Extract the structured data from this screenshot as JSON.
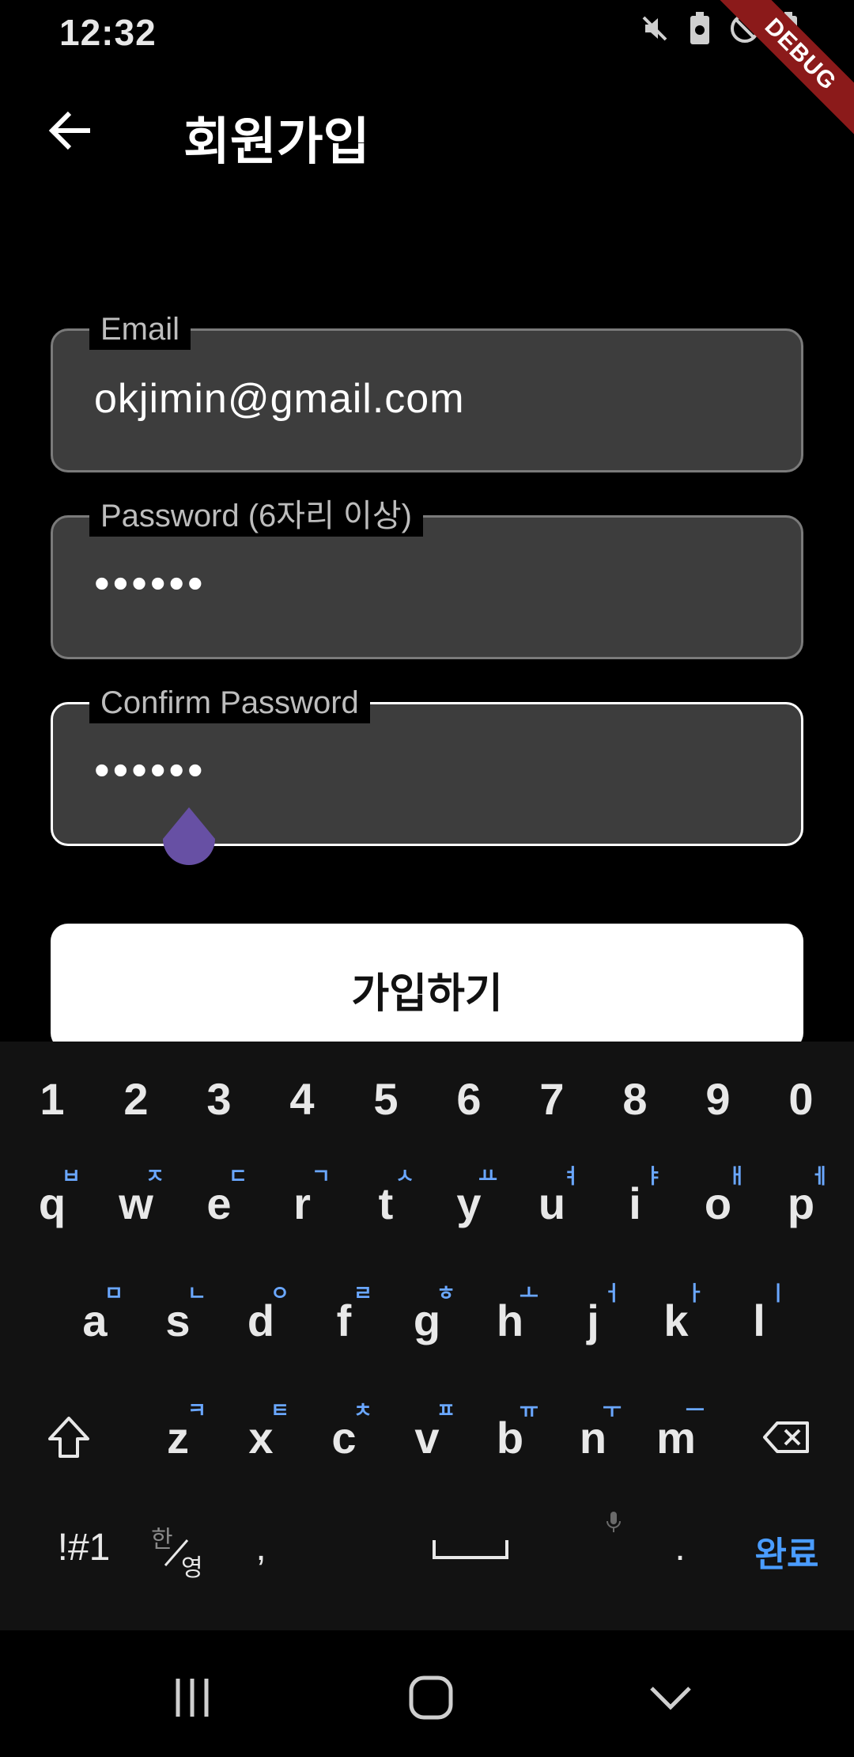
{
  "status_bar": {
    "time": "12:32",
    "debug_label": "DEBUG"
  },
  "app_bar": {
    "title": "회원가입"
  },
  "form": {
    "email": {
      "label": "Email",
      "value": "okjimin@gmail.com"
    },
    "password": {
      "label": "Password (6자리 이상)",
      "value": "••••••"
    },
    "confirm_password": {
      "label": "Confirm Password",
      "value": "••••••"
    },
    "submit_label": "가입하기"
  },
  "keyboard": {
    "number_row": [
      "1",
      "2",
      "3",
      "4",
      "5",
      "6",
      "7",
      "8",
      "9",
      "0"
    ],
    "row1": [
      {
        "key": "q",
        "sub": "ㅂ"
      },
      {
        "key": "w",
        "sub": "ㅈ"
      },
      {
        "key": "e",
        "sub": "ㄷ"
      },
      {
        "key": "r",
        "sub": "ㄱ"
      },
      {
        "key": "t",
        "sub": "ㅅ"
      },
      {
        "key": "y",
        "sub": "ㅛ"
      },
      {
        "key": "u",
        "sub": "ㅕ"
      },
      {
        "key": "i",
        "sub": "ㅑ"
      },
      {
        "key": "o",
        "sub": "ㅐ"
      },
      {
        "key": "p",
        "sub": "ㅔ"
      }
    ],
    "row2": [
      {
        "key": "a",
        "sub": "ㅁ"
      },
      {
        "key": "s",
        "sub": "ㄴ"
      },
      {
        "key": "d",
        "sub": "ㅇ"
      },
      {
        "key": "f",
        "sub": "ㄹ"
      },
      {
        "key": "g",
        "sub": "ㅎ"
      },
      {
        "key": "h",
        "sub": "ㅗ"
      },
      {
        "key": "j",
        "sub": "ㅓ"
      },
      {
        "key": "k",
        "sub": "ㅏ"
      },
      {
        "key": "l",
        "sub": "ㅣ"
      }
    ],
    "row3": [
      {
        "key": "z",
        "sub": "ㅋ"
      },
      {
        "key": "x",
        "sub": "ㅌ"
      },
      {
        "key": "c",
        "sub": "ㅊ"
      },
      {
        "key": "v",
        "sub": "ㅍ"
      },
      {
        "key": "b",
        "sub": "ㅠ"
      },
      {
        "key": "n",
        "sub": "ㅜ"
      },
      {
        "key": "m",
        "sub": "ㅡ"
      }
    ],
    "symbols_key": "!#1",
    "lang_key_top": "한",
    "lang_key_bottom": "영",
    "comma_key": ",",
    "period_key": ".",
    "done_key": "완료",
    "icons": [
      "shift-icon",
      "backspace-icon",
      "space-icon",
      "mic-icon"
    ]
  },
  "nav_bar": {
    "icons": [
      "recents-icon",
      "home-icon",
      "back-down-icon"
    ]
  }
}
